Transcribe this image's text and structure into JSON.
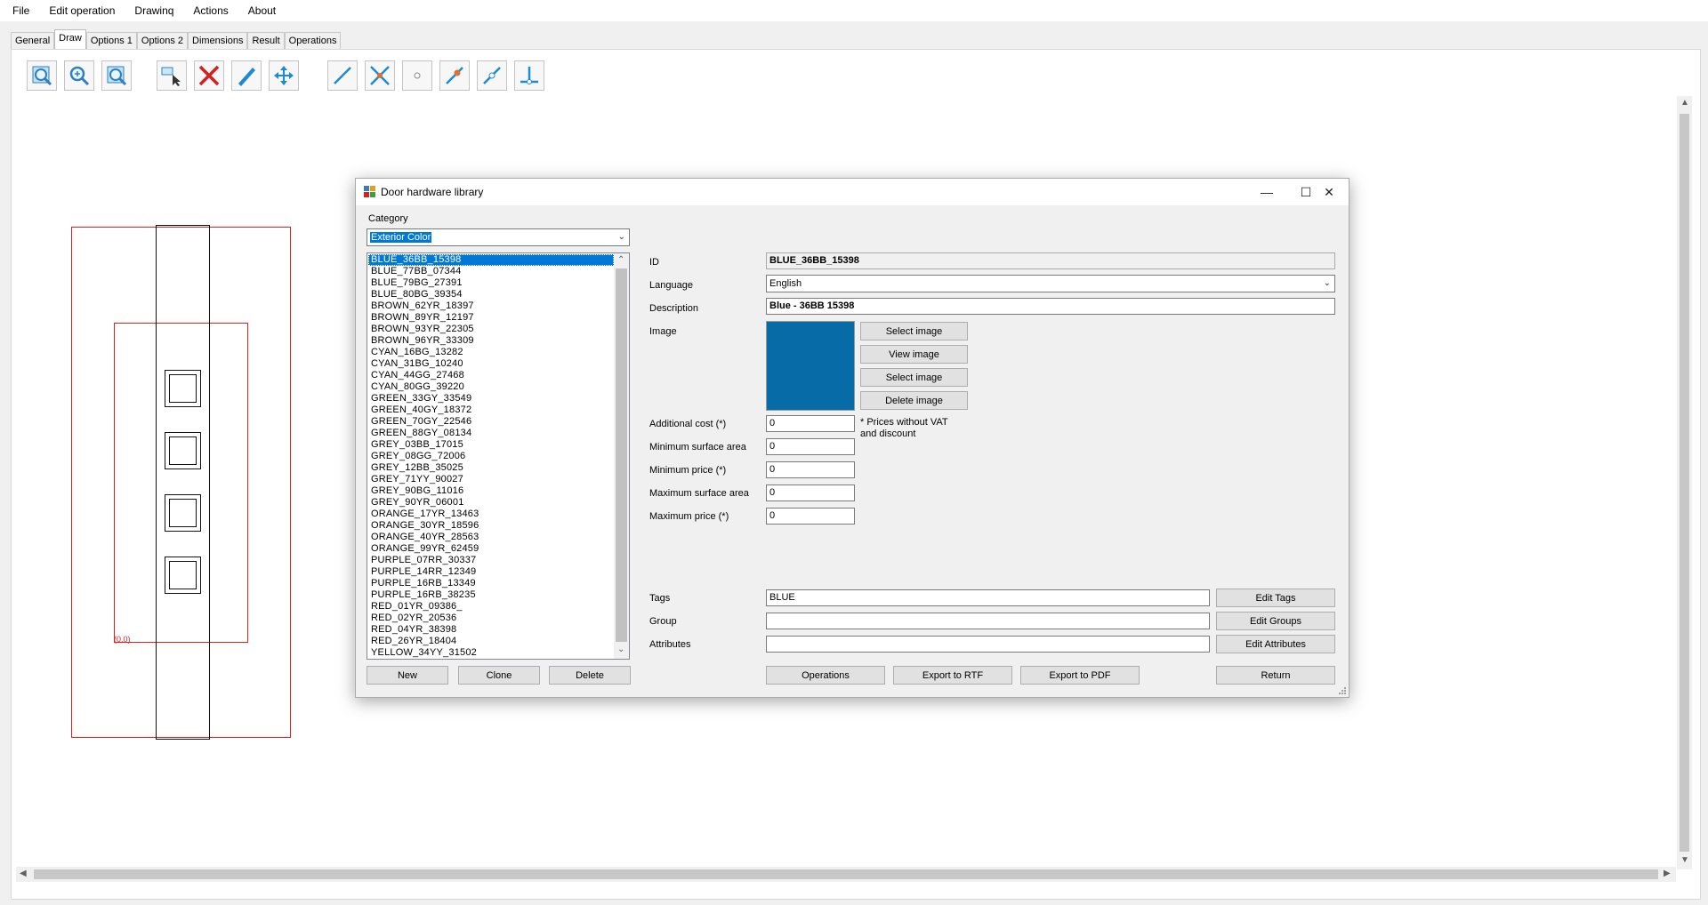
{
  "menu": [
    "File",
    "Edit operation",
    "Drawinq",
    "Actions",
    "About"
  ],
  "tabs": [
    "General",
    "Draw",
    "Options 1",
    "Options 2",
    "Dimensions",
    "Result",
    "Operations"
  ],
  "active_tab": "Draw",
  "toolbar_icons": [
    "zoom-in-icon",
    "zoom-all-icon",
    "zoom-out-icon",
    "select-pointer-icon",
    "delete-x-icon",
    "pencil-draw-icon",
    "move-arrows-icon",
    "line-icon",
    "intersect-icon",
    "point-icon",
    "line-point-icon",
    "line-node-icon",
    "perpendicular-icon"
  ],
  "drawing": {
    "origin_label": "(0,0)"
  },
  "dialog": {
    "title": "Door hardware library",
    "category_label": "Category",
    "category_value": "Exterior Color",
    "items": [
      "BLUE_36BB_15398",
      "BLUE_77BB_07344",
      "BLUE_79BG_27391",
      "BLUE_80BG_39354",
      "BROWN_62YR_18397",
      "BROWN_89YR_12197",
      "BROWN_93YR_22305",
      "BROWN_96YR_33309",
      "CYAN_16BG_13282",
      "CYAN_31BG_10240",
      "CYAN_44GG_27468",
      "CYAN_80GG_39220",
      "GREEN_33GY_33549",
      "GREEN_40GY_18372",
      "GREEN_70GY_22546",
      "GREEN_88GY_08134",
      "GREY_03BB_17015",
      "GREY_08GG_72006",
      "GREY_12BB_35025",
      "GREY_71YY_90027",
      "GREY_90BG_11016",
      "GREY_90YR_06001",
      "ORANGE_17YR_13463",
      "ORANGE_30YR_18596",
      "ORANGE_40YR_28563",
      "ORANGE_99YR_62459",
      "PURPLE_07RR_30337",
      "PURPLE_14RR_12349",
      "PURPLE_16RB_13349",
      "PURPLE_16RB_38235",
      "RED_01YR_09386_",
      "RED_02YR_20536",
      "RED_04YR_38398",
      "RED_26YR_18404",
      "YELLOW_34YY_31502"
    ],
    "selected_index": 0,
    "fields": {
      "id_label": "ID",
      "id_value": "BLUE_36BB_15398",
      "language_label": "Language",
      "language_value": "English",
      "description_label": "Description",
      "description_value": "Blue - 36BB 15398",
      "image_label": "Image",
      "additional_cost_label": "Additional cost  (*)",
      "additional_cost_value": "0",
      "min_surface_label": "Minimum surface area",
      "min_surface_value": "0",
      "min_price_label": "Minimum price (*)",
      "min_price_value": "0",
      "max_surface_label": "Maximum surface area",
      "max_surface_value": "0",
      "max_price_label": "Maximum price (*)",
      "max_price_value": "0",
      "price_note": "* Prices without VAT and discount",
      "tags_label": "Tags",
      "tags_value": "BLUE",
      "group_label": "Group",
      "group_value": "",
      "attributes_label": "Attributes",
      "attributes_value": ""
    },
    "image_color": "#066ba7",
    "image_buttons": [
      "Select image",
      "View image",
      "Select image",
      "Delete image"
    ],
    "buttons": {
      "edit_tags": "Edit Tags",
      "edit_groups": "Edit Groups",
      "edit_attributes": "Edit Attributes",
      "new": "New",
      "clone": "Clone",
      "delete": "Delete",
      "operations": "Operations",
      "export_rtf": "Export to RTF",
      "export_pdf": "Export to PDF",
      "return": "Return"
    }
  }
}
